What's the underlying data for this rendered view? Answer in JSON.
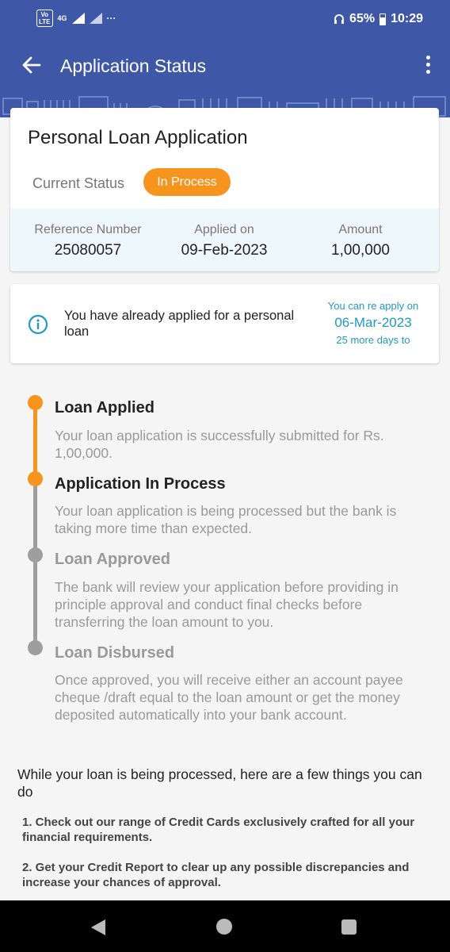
{
  "status_bar": {
    "volte_top": "Vo",
    "volte_bottom": "LTE",
    "network": "4G",
    "more": "···",
    "battery": "65%",
    "time": "10:29"
  },
  "header": {
    "title": "Application Status"
  },
  "application": {
    "title": "Personal Loan Application",
    "current_status_label": "Current Status",
    "status": "In Process",
    "details": [
      {
        "label": "Reference Number",
        "value": "25080057"
      },
      {
        "label": "Applied on",
        "value": "09-Feb-2023"
      },
      {
        "label": "Amount",
        "value": "1,00,000"
      }
    ]
  },
  "notice": {
    "message": "You have already applied for a personal loan",
    "reapply_label": "You can re apply on",
    "reapply_date": "06-Mar-2023",
    "days_left": "25 more days to"
  },
  "timeline": [
    {
      "title": "Loan Applied",
      "description": "Your loan application is successfully submitted for Rs. 1,00,000.",
      "state": "done"
    },
    {
      "title": "Application In Process",
      "description": "Your loan application is being processed but the bank is taking more time than expected.",
      "state": "current"
    },
    {
      "title": "Loan Approved",
      "description": "The bank will review your application before providing in principle approval and conduct final checks before transferring the loan amount to you.",
      "state": "pending"
    },
    {
      "title": "Loan Disbursed",
      "description": "Once approved, you will receive either an account payee cheque /draft equal to the loan amount or get the money deposited automatically into your bank account.",
      "state": "pending"
    }
  ],
  "tips": {
    "title": "While your loan is being processed, here are a few things you can do",
    "items": [
      "1. Check out our range of Credit Cards exclusively crafted for all your financial requirements.",
      "2. Get your Credit Report to clear up any possible discrepancies and increase your chances of approval."
    ]
  },
  "colors": {
    "header": "#3e57a7",
    "accent": "#f7941d",
    "info": "#1f9bbd",
    "pending": "#9e9e9e"
  }
}
